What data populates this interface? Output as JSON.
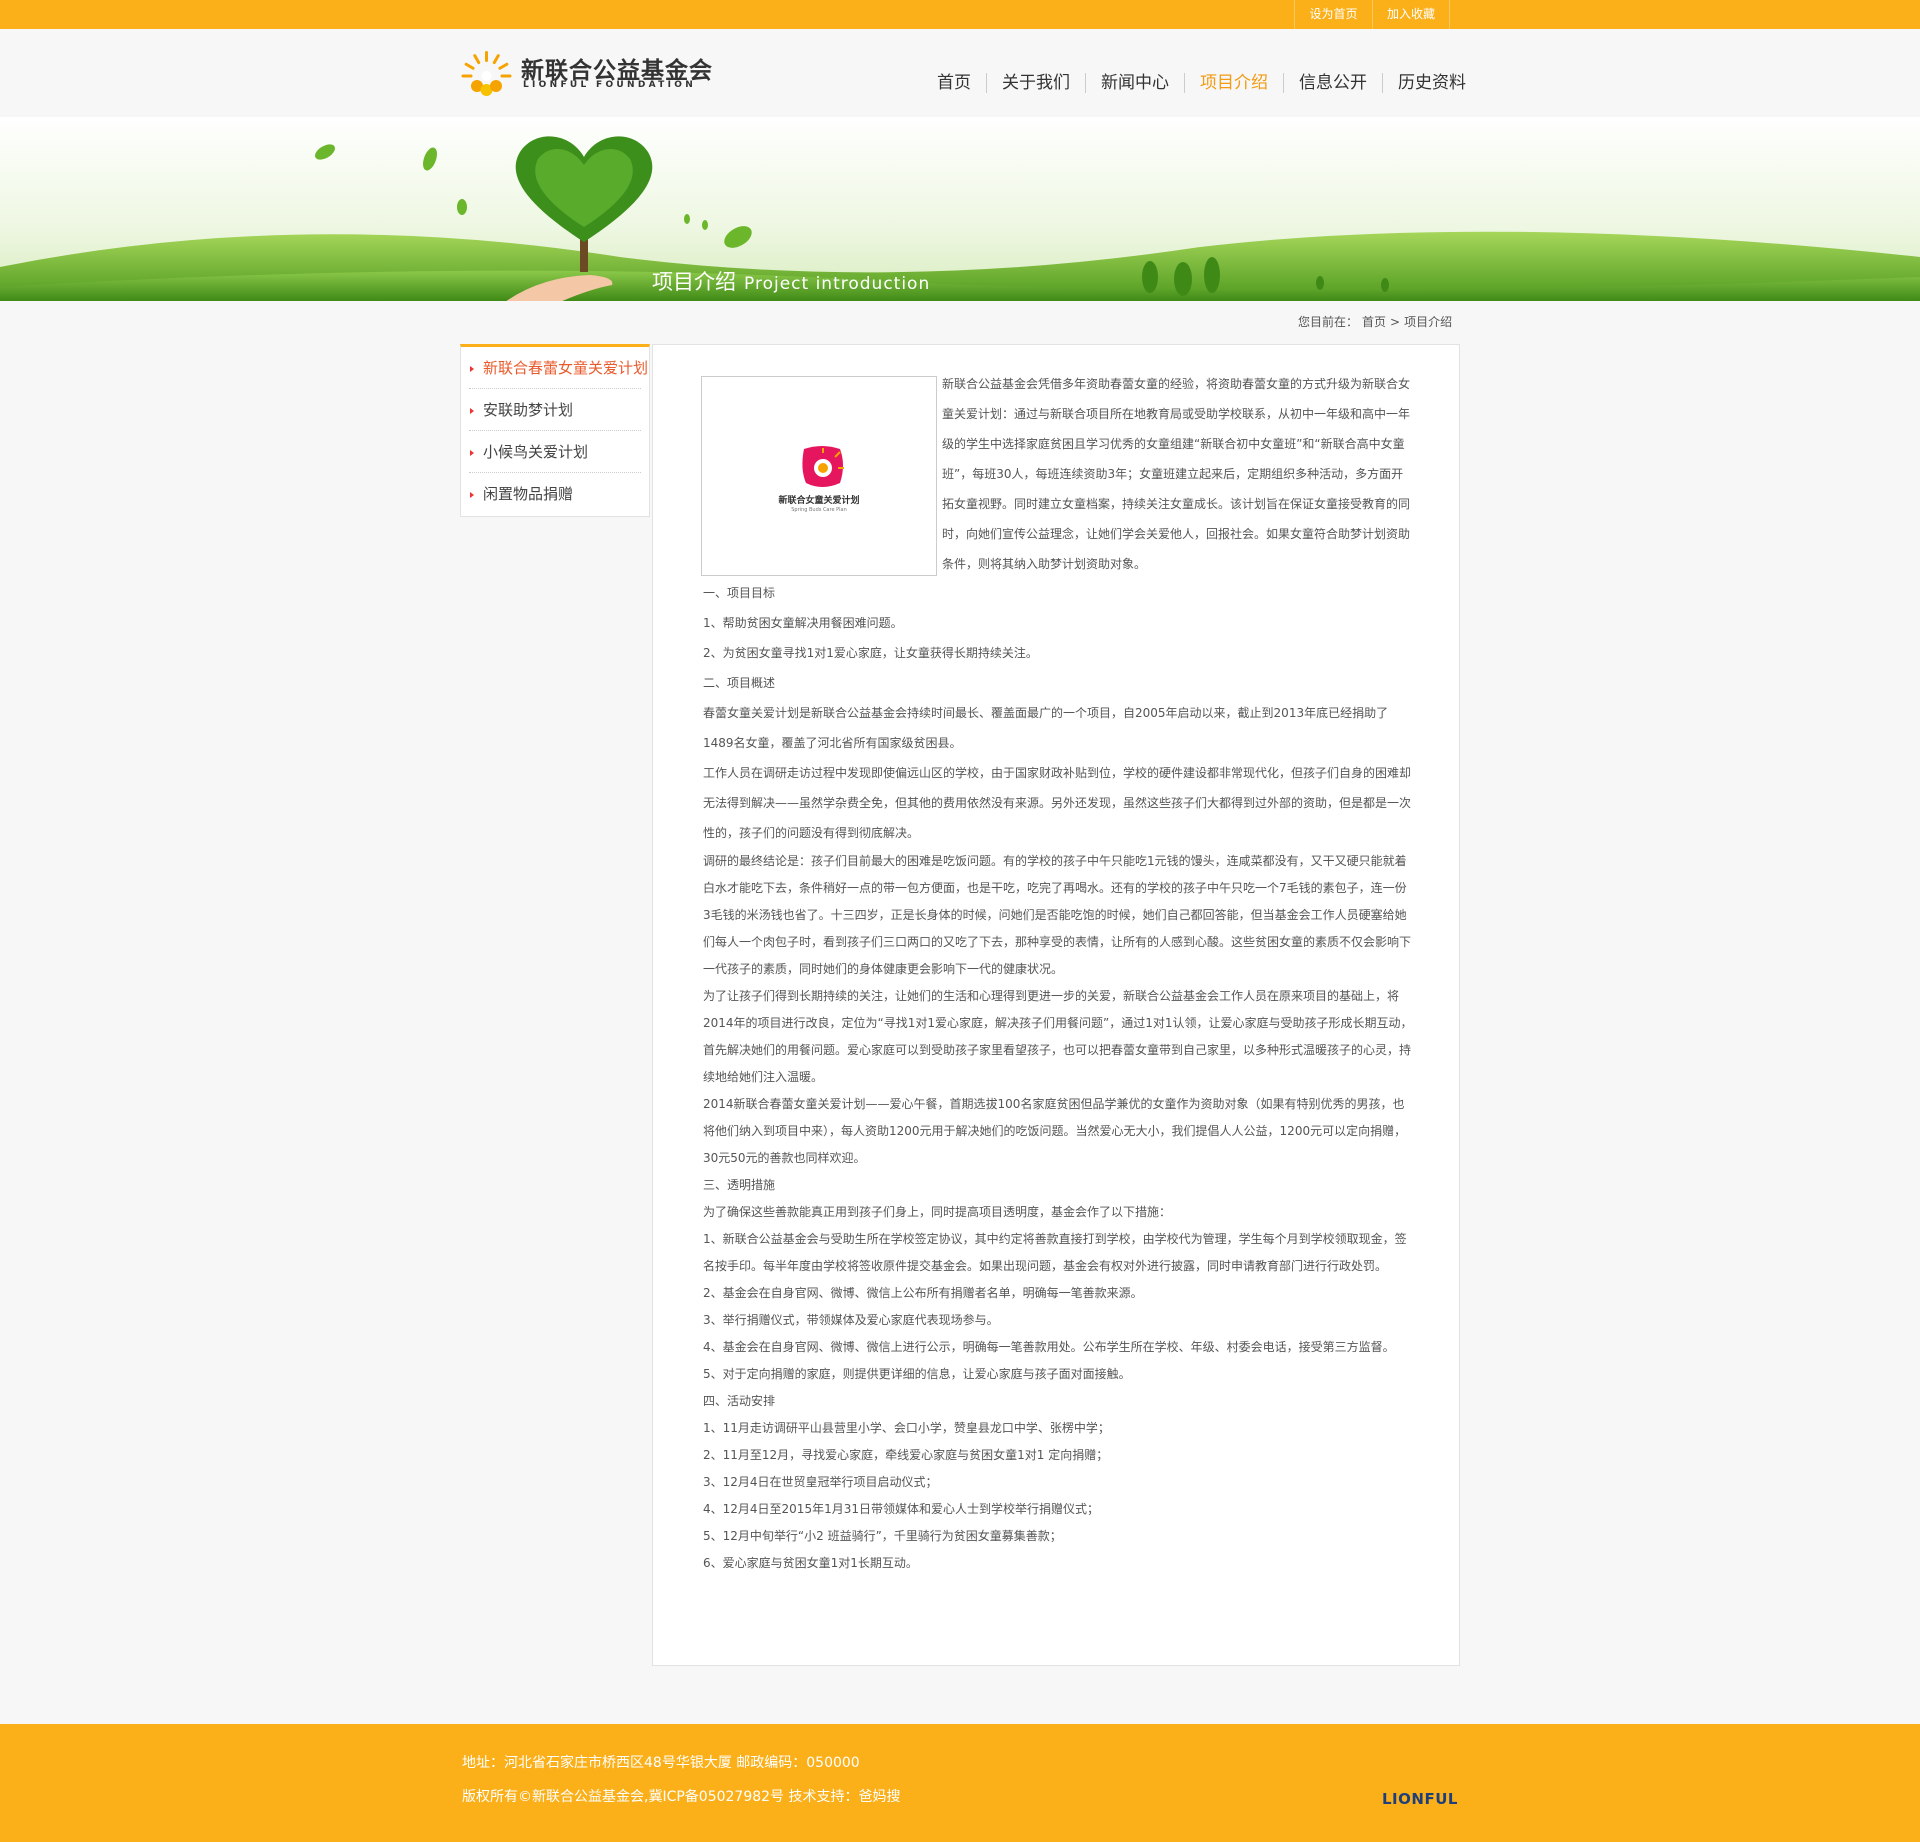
{
  "topbar": {
    "set_home": "设为首页",
    "add_favorite": "加入收藏"
  },
  "logo": {
    "name": "新联合公益基金会",
    "sub": "LIONFUL FOUNDATION"
  },
  "nav": {
    "items": [
      "首页",
      "关于我们",
      "新闻中心",
      "项目介绍",
      "信息公开",
      "历史资料"
    ],
    "active": "项目介绍"
  },
  "banner": {
    "title": "项目介绍",
    "subtitle": "Project introduction"
  },
  "breadcrumb": {
    "prefix": "您目前在：",
    "home": "首页",
    "sep": ">",
    "current": "项目介绍"
  },
  "sidebar": {
    "items": [
      "新联合春蕾女童关爱计划",
      "安联助梦计划",
      "小候鸟关爱计划",
      "闲置物品捐赠"
    ]
  },
  "article": {
    "image_caption": "新联合女童关爱计划",
    "image_subcaption": "Spring Buds Care Plan",
    "intro": "新联合公益基金会凭借多年资助春蕾女童的经验，将资助春蕾女童的方式升级为新联合女童关爱计划：通过与新联合项目所在地教育局或受助学校联系，从初中一年级和高中一年级的学生中选择家庭贫困且学习优秀的女童组建“新联合初中女童班”和“新联合高中女童班”，每班30人，每班连续资助3年；女童班建立起来后，定期组织多种活动，多方面开拓女童视野。同时建立女童档案，持续关注女童成长。该计划旨在保证女童接受教育的同时，向她们宣传公益理念，让她们学会关爱他人，回报社会。如果女童符合助梦计划资助条件，则将其纳入助梦计划资助对象。",
    "paragraphs": [
      " 一、项目目标",
      "1、帮助贫困女童解决用餐困难问题。",
      "2、为贫困女童寻找1对1爱心家庭，让女童获得长期持续关注。",
      "二、项目概述",
      "春蕾女童关爱计划是新联合公益基金会持续时间最长、覆盖面最广的一个项目，自2005年启动以来，截止到2013年底已经捐助了1489名女童，覆盖了河北省所有国家级贫困县。",
      "工作人员在调研走访过程中发现即使偏远山区的学校，由于国家财政补贴到位，学校的硬件建设都非常现代化，但孩子们自身的困难却无法得到解决——虽然学杂费全免，但其他的费用依然没有来源。另外还发现，虽然这些孩子们大都得到过外部的资助，但是都是一次性的，孩子们的问题没有得到彻底解决。",
      "调研的最终结论是：孩子们目前最大的困难是吃饭问题。有的学校的孩子中午只能吃1元钱的馒头，连咸菜都没有，又干又硬只能就着白水才能吃下去，条件稍好一点的带一包方便面，也是干吃，吃完了再喝水。还有的学校的孩子中午只吃一个7毛钱的素包子，连一份3毛钱的米汤钱也省了。十三四岁，正是长身体的时候，问她们是否能吃饱的时候，她们自己都回答能，但当基金会工作人员硬塞给她们每人一个肉包子时，看到孩子们三口两口的又吃了下去，那种享受的表情，让所有的人感到心酸。这些贫困女童的素质不仅会影响下一代孩子的素质，同时她们的身体健康更会影响下一代的健康状况。",
      "为了让孩子们得到长期持续的关注，让她们的生活和心理得到更进一步的关爱，新联合公益基金会工作人员在原来项目的基础上，将2014年的项目进行改良，定位为“寻找1对1爱心家庭，解决孩子们用餐问题”，通过1对1认领，让爱心家庭与受助孩子形成长期互动，首先解决她们的用餐问题。爱心家庭可以到受助孩子家里看望孩子，也可以把春蕾女童带到自己家里，以多种形式温暖孩子的心灵，持续地给她们注入温暖。",
      "2014新联合春蕾女童关爱计划——爱心午餐，首期选拔100名家庭贫困但品学兼优的女童作为资助对象（如果有特别优秀的男孩，也将他们纳入到项目中来），每人资助1200元用于解决她们的吃饭问题。当然爱心无大小，我们提倡人人公益，1200元可以定向捐赠，30元50元的善款也同样欢迎。",
      "三、透明措施",
      "为了确保这些善款能真正用到孩子们身上，同时提高项目透明度，基金会作了以下措施：",
      "1、新联合公益基金会与受助生所在学校签定协议，其中约定将善款直接打到学校，由学校代为管理，学生每个月到学校领取现金，签名按手印。每半年度由学校将签收原件提交基金会。如果出现问题，基金会有权对外进行披露，同时申请教育部门进行行政处罚。",
      "2、基金会在自身官网、微博、微信上公布所有捐赠者名单，明确每一笔善款来源。",
      "3、举行捐赠仪式，带领媒体及爱心家庭代表现场参与。",
      "4、基金会在自身官网、微博、微信上进行公示，明确每一笔善款用处。公布学生所在学校、年级、村委会电话，接受第三方监督。",
      "5、对于定向捐赠的家庭，则提供更详细的信息，让爱心家庭与孩子面对面接触。",
      "四、活动安排",
      "1、11月走访调研平山县营里小学、会口小学，赞皇县龙口中学、张楞中学；",
      "2、11月至12月，寻找爱心家庭，牵线爱心家庭与贫困女童1对1 定向捐赠；",
      "3、12月4日在世贸皇冠举行项目启动仪式；",
      "4、12月4日至2015年1月31日带领媒体和爱心人士到学校举行捐赠仪式；",
      "5、12月中旬举行“小2 班益骑行”，千里骑行为贫困女童募集善款；",
      "6、爱心家庭与贫困女童1对1长期互动。"
    ]
  },
  "footer": {
    "address": "地址：河北省石家庄市桥西区48号华银大厦    邮政编码：050000",
    "copyright": "版权所有©新联合公益基金会,冀ICP备05027982号 技术支持：爸妈搜",
    "logo": "LIONFUL"
  },
  "colors": {
    "orange": "#fbb019",
    "nav_active": "#f29b13",
    "green": "#7bbf34"
  }
}
